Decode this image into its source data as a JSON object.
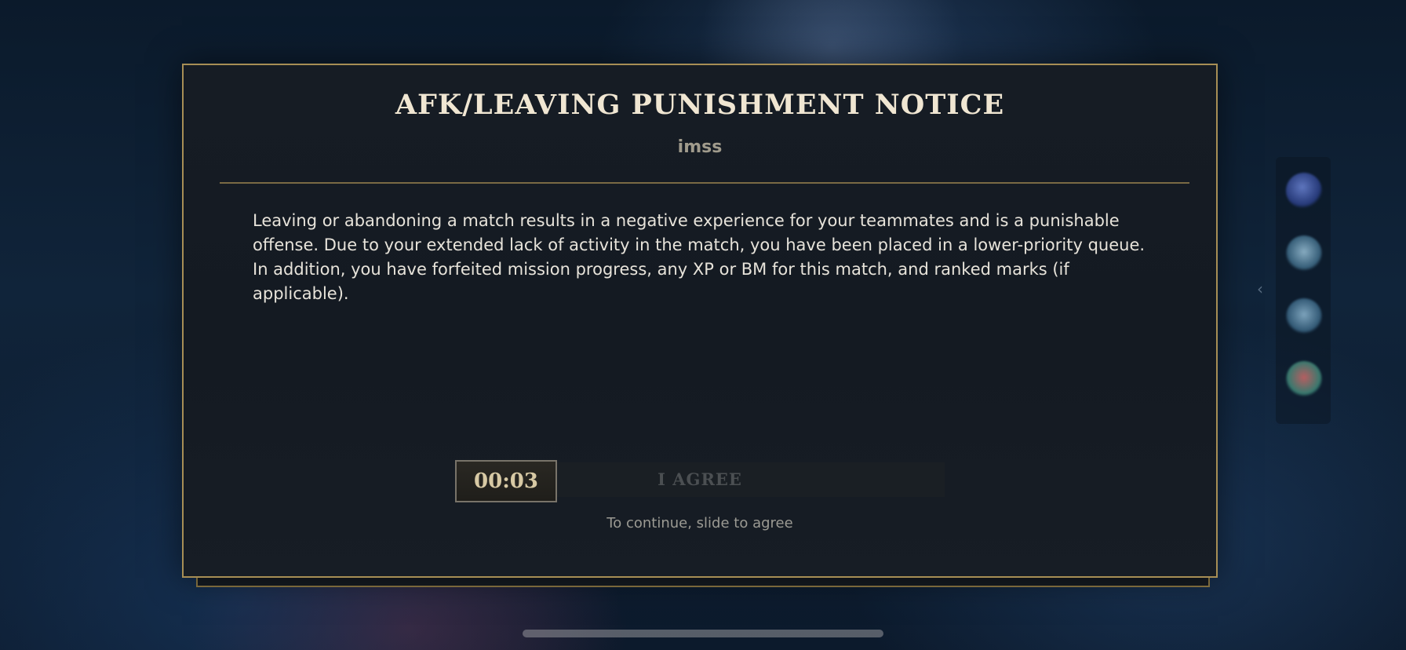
{
  "dialog": {
    "title": "AFK/LEAVING PUNISHMENT NOTICE",
    "player_name": "imss",
    "body": "Leaving or abandoning a match results in a negative experience for your teammates and is a punishable offense. Due to your extended lack of activity in the match, you have been placed in a lower-priority queue. In addition, you have forfeited mission progress, any XP or BM for this match, and ranked marks (if applicable).",
    "slider": {
      "timer": "00:03",
      "label": "I AGREE"
    },
    "hint": "To continue, slide to agree"
  },
  "colors": {
    "border_gold": "#a78e55",
    "title_text": "#f0e6d2",
    "panel_bg": "#161c24"
  },
  "icons": [
    "rail-champion-icon",
    "rail-chest-icon",
    "rail-chest-icon",
    "rail-emote-icon",
    "chevron-left-icon"
  ]
}
